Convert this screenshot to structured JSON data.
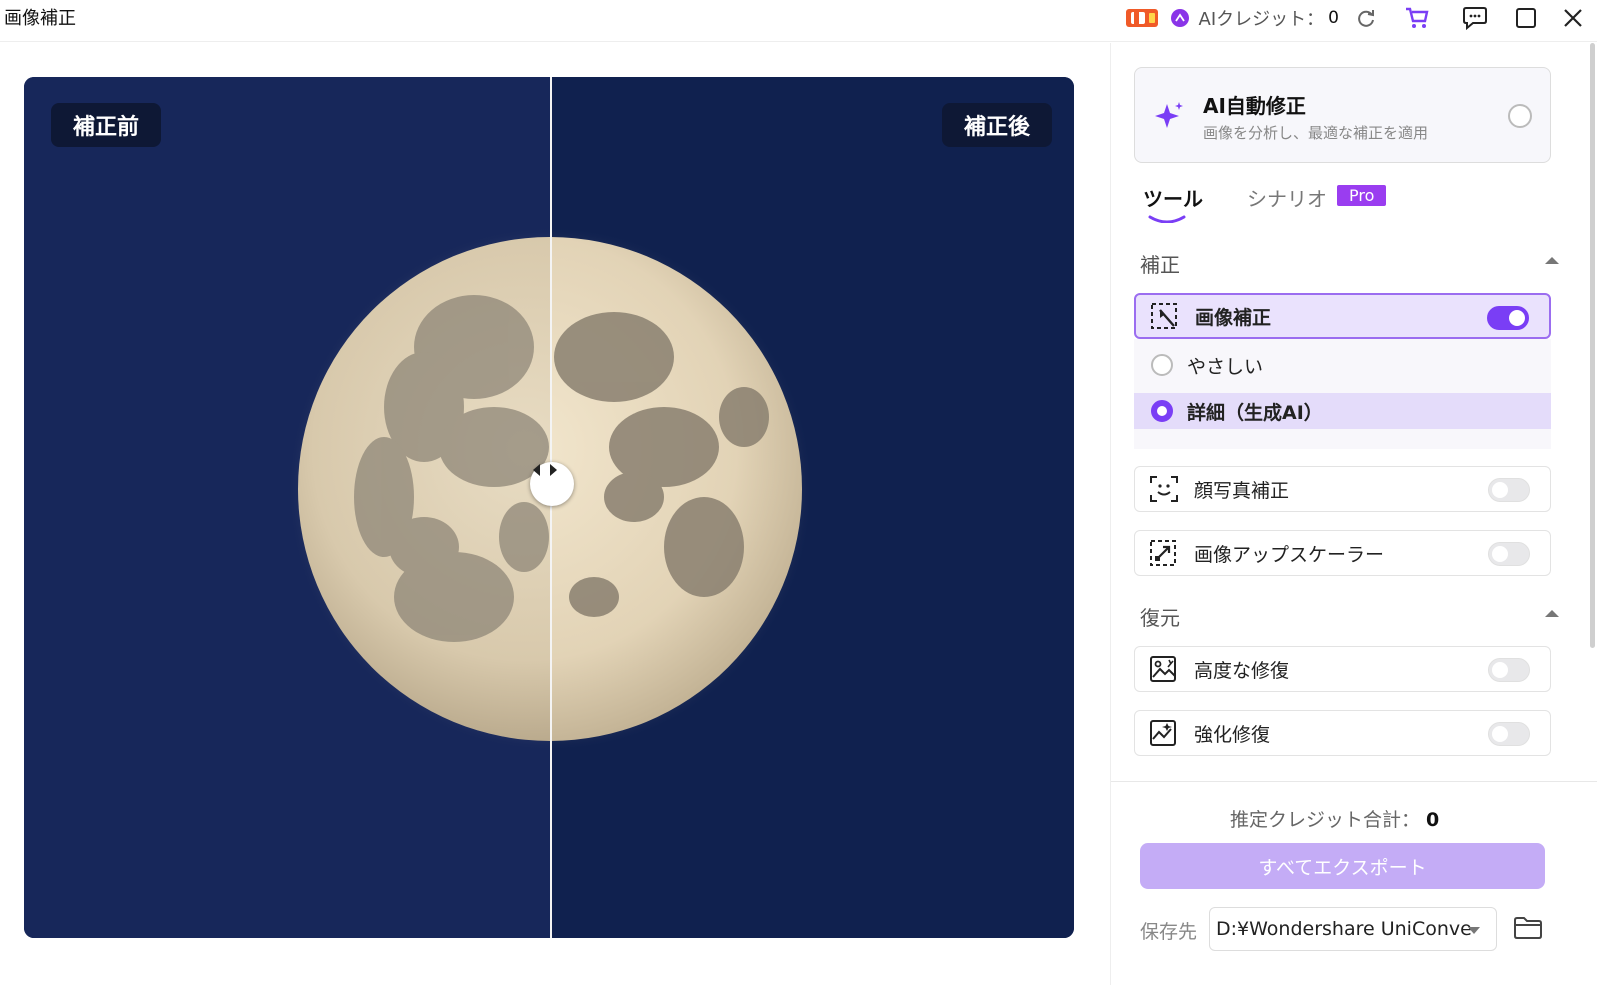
{
  "window": {
    "title": "画像補正"
  },
  "titlebar": {
    "credit_label": "AIクレジット：",
    "credit_value": "0",
    "icons": [
      "gift-icon",
      "ai-credit-icon",
      "refresh-icon",
      "cart-icon",
      "feedback-icon",
      "maximize-icon",
      "close-icon"
    ]
  },
  "preview": {
    "before_label": "補正前",
    "after_label": "補正後",
    "split_position": 0.5,
    "background_color": "#142452"
  },
  "panel": {
    "ai_auto": {
      "title": "AI自動修正",
      "subtitle": "画像を分析し、最適な補正を適用",
      "enabled": false
    },
    "tabs": [
      {
        "label": "ツール",
        "active": true
      },
      {
        "label": "シナリオ",
        "active": false,
        "badge": "Pro"
      }
    ],
    "sections": [
      {
        "title": "補正",
        "expanded": true,
        "tools": [
          {
            "label": "画像補正",
            "enabled": true,
            "icon": "image-enhance-icon",
            "options": [
              {
                "label": "やさしい",
                "selected": false
              },
              {
                "label": "詳細（生成AI）",
                "selected": true
              }
            ]
          },
          {
            "label": "顔写真補正",
            "enabled": false,
            "icon": "face-enhance-icon"
          },
          {
            "label": "画像アップスケーラー",
            "enabled": false,
            "icon": "upscale-icon"
          }
        ]
      },
      {
        "title": "復元",
        "expanded": true,
        "tools": [
          {
            "label": "高度な修復",
            "enabled": false,
            "icon": "advanced-repair-icon"
          },
          {
            "label": "強化修復",
            "enabled": false,
            "icon": "enhanced-repair-icon"
          }
        ]
      }
    ],
    "estimate_label": "推定クレジット合計：",
    "estimate_value": "0",
    "export_label": "すべてエクスポート",
    "save_label": "保存先",
    "save_path": "D:¥Wondershare UniConve"
  },
  "colors": {
    "accent": "#7a3ef5",
    "export_button": "#c4acf6",
    "pro_badge": "#9a3df0"
  }
}
